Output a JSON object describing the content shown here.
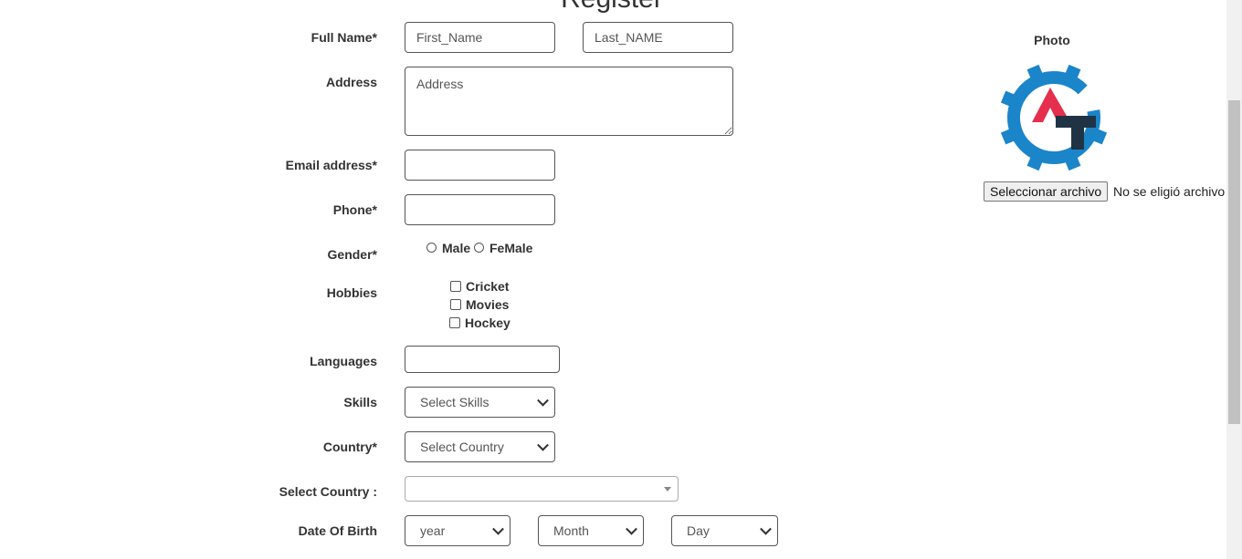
{
  "page": {
    "title": "Register"
  },
  "form": {
    "full_name_label": "Full Name*",
    "first_name_placeholder": "First_Name",
    "last_name_placeholder": "Last_NAME",
    "address_label": "Address",
    "address_value": "Address",
    "email_label": "Email address*",
    "phone_label": "Phone*",
    "gender_label": "Gender*",
    "gender_options": [
      "Male",
      "FeMale"
    ],
    "hobbies_label": "Hobbies",
    "hobbies": [
      "Cricket",
      "Movies",
      "Hockey"
    ],
    "languages_label": "Languages",
    "skills_label": "Skills",
    "skills_selected": "Select Skills",
    "country_label": "Country*",
    "country_selected": "Select Country",
    "select_country_label": "Select Country :",
    "select_country_value": "",
    "dob_label": "Date Of Birth",
    "dob_year": "year",
    "dob_month": "Month",
    "dob_day": "Day"
  },
  "photo": {
    "label": "Photo",
    "file_button": "Seleccionar archivo",
    "file_status": "No se eligió archivo",
    "logo_colors": {
      "gear": "#1b85c9",
      "a_mark": "#e62e4d",
      "t_mark": "#1f3345"
    }
  }
}
